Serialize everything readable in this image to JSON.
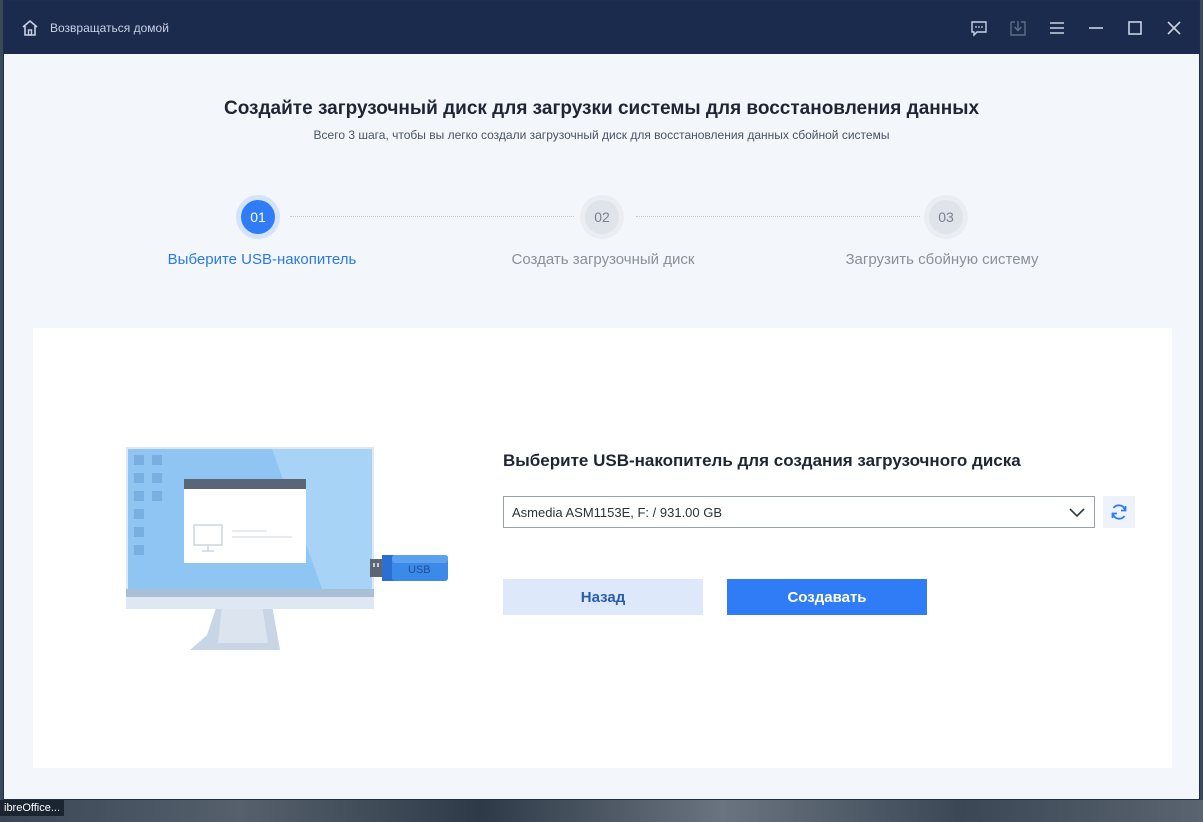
{
  "titlebar": {
    "home_label": "Возвращаться домой",
    "icons": [
      "home-icon",
      "feedback-icon",
      "download-icon",
      "menu-icon",
      "minimize-icon",
      "maximize-icon",
      "close-icon"
    ]
  },
  "header": {
    "title": "Создайте загрузочный диск для загрузки системы для восстановления данных",
    "subtitle": "Всего 3 шага, чтобы вы легко создали загрузочный диск для восстановления данных сбойной системы"
  },
  "steps": [
    {
      "number": "01",
      "label": "Выберите USB-накопитель",
      "active": true
    },
    {
      "number": "02",
      "label": "Создать загрузочный диск",
      "active": false
    },
    {
      "number": "03",
      "label": "Загрузить сбойную систему",
      "active": false
    }
  ],
  "main": {
    "form_title": "Выберите USB-накопитель для создания загрузочного диска",
    "selected_drive": "Asmedia ASM1153E, F: / 931.00 GB",
    "back_label": "Назад",
    "create_label": "Создавать",
    "usb_text": "USB"
  },
  "taskbar": {
    "fragment": "ibreOffice..."
  },
  "colors": {
    "accent": "#2f7cf6",
    "titlebar": "#1b2b4d",
    "active_step_text": "#2a7be4"
  }
}
